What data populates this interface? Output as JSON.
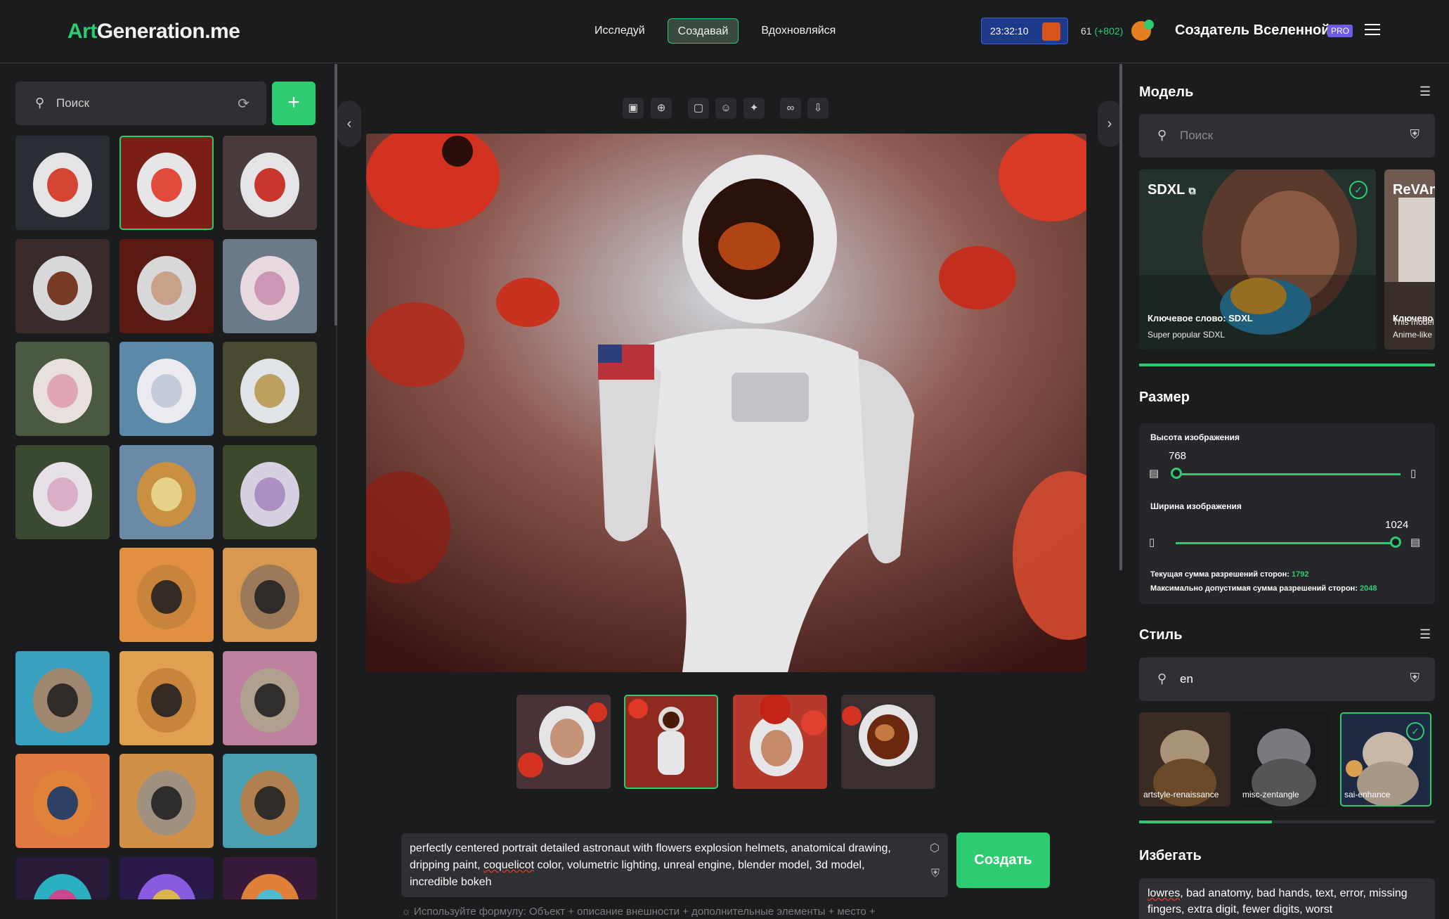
{
  "header": {
    "logo_part1": "Art",
    "logo_part2": "Generation.me",
    "nav": [
      {
        "label": "Исследуй"
      },
      {
        "label": "Создавай"
      },
      {
        "label": "Вдохновляйся"
      }
    ],
    "timer": "23:32:10",
    "coins": "61",
    "coins_bonus": "(+802)",
    "username": "Создатель Вселенной",
    "badge": "PRO"
  },
  "left": {
    "search_placeholder": "Поиск"
  },
  "prompt": {
    "part1": "perfectly centered portrait detailed astronaut with flowers explosion helmets, anatomical drawing, dripping paint, ",
    "underlined": "coquelicot",
    "part2": " color, volumetric lighting, unreal engine, blender model, 3d model, incredible bokeh",
    "create_label": "Создать",
    "hint": "Используйте формулу: Объект + описание внешности + дополнительные элементы + место +"
  },
  "model": {
    "title": "Модель",
    "search_placeholder": "Поиск",
    "cards": [
      {
        "name": "SDXL",
        "keyword": "Ключевое слово: SDXL",
        "desc": "Super popular SDXL"
      },
      {
        "name": "ReVAn",
        "keyword": "Ключево",
        "desc": "This model",
        "desc2": "Anime-like"
      }
    ]
  },
  "size": {
    "title": "Размер",
    "height_label": "Высота изображения",
    "height_value": "768",
    "width_label": "Ширина изображения",
    "width_value": "1024",
    "sum_label": "Текущая сумма разрешений сторон:",
    "sum_value": "1792",
    "max_label": "Максимально допустимая сумма разрешений сторон:",
    "max_value": "2048"
  },
  "style": {
    "title": "Стиль",
    "search_value": "en",
    "cards": [
      {
        "label": "artstyle-renaissance"
      },
      {
        "label": "misc-zentangle"
      },
      {
        "label": "sai-enhance"
      }
    ]
  },
  "avoid": {
    "title": "Избегать",
    "underlined": "lowres",
    "text": ", bad anatomy, bad hands, text, error, missing fingers, extra digit, fewer digits, worst"
  }
}
